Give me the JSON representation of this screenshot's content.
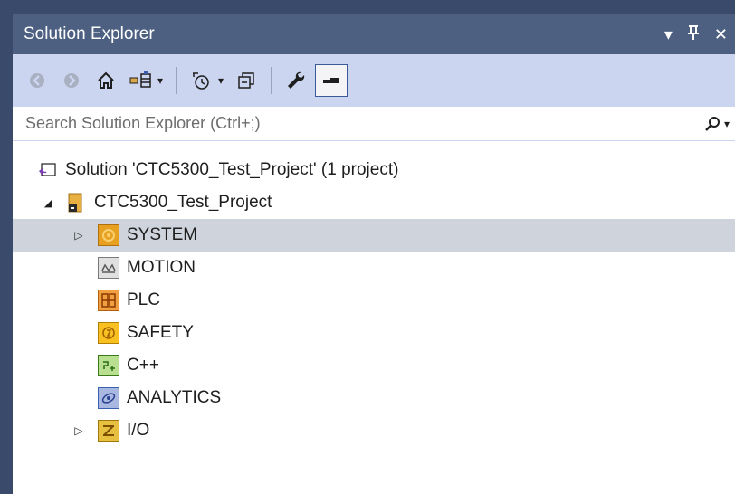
{
  "panel": {
    "title": "Solution Explorer",
    "controls": {
      "dropdown": "▾",
      "pin": "ꟸ",
      "close": "✕"
    }
  },
  "toolbar": {
    "back_glyph": "◀",
    "forward_glyph": "▶",
    "home_glyph": "⌂",
    "sync_glyph": "⇄",
    "pending_glyph": "◷",
    "collapse_glyph": "▣",
    "properties_glyph": "🔧",
    "preview_glyph": "▬",
    "dropdown_glyph": "▾"
  },
  "search": {
    "placeholder": "Search Solution Explorer (Ctrl+;)",
    "icon_glyph": "⌕",
    "dropdown_glyph": "▾"
  },
  "tree": {
    "solution": {
      "label": "Solution 'CTC5300_Test_Project' (1 project)"
    },
    "project": {
      "label": "CTC5300_Test_Project",
      "expander": "◢"
    },
    "items": [
      {
        "label": "SYSTEM",
        "expander": "▷",
        "selected": true,
        "icon": "system-icon",
        "color": "#e8a020"
      },
      {
        "label": "MOTION",
        "icon": "motion-icon",
        "color": "#9a9a9a"
      },
      {
        "label": "PLC",
        "icon": "plc-icon",
        "color": "#e07a1a"
      },
      {
        "label": "SAFETY",
        "icon": "safety-icon",
        "color": "#f0b400"
      },
      {
        "label": "C++",
        "icon": "cpp-icon",
        "color": "#4a9a2a"
      },
      {
        "label": "ANALYTICS",
        "icon": "analytics-icon",
        "color": "#3a5fb0"
      },
      {
        "label": "I/O",
        "expander": "▷",
        "icon": "io-icon",
        "color": "#d4a020"
      }
    ]
  }
}
